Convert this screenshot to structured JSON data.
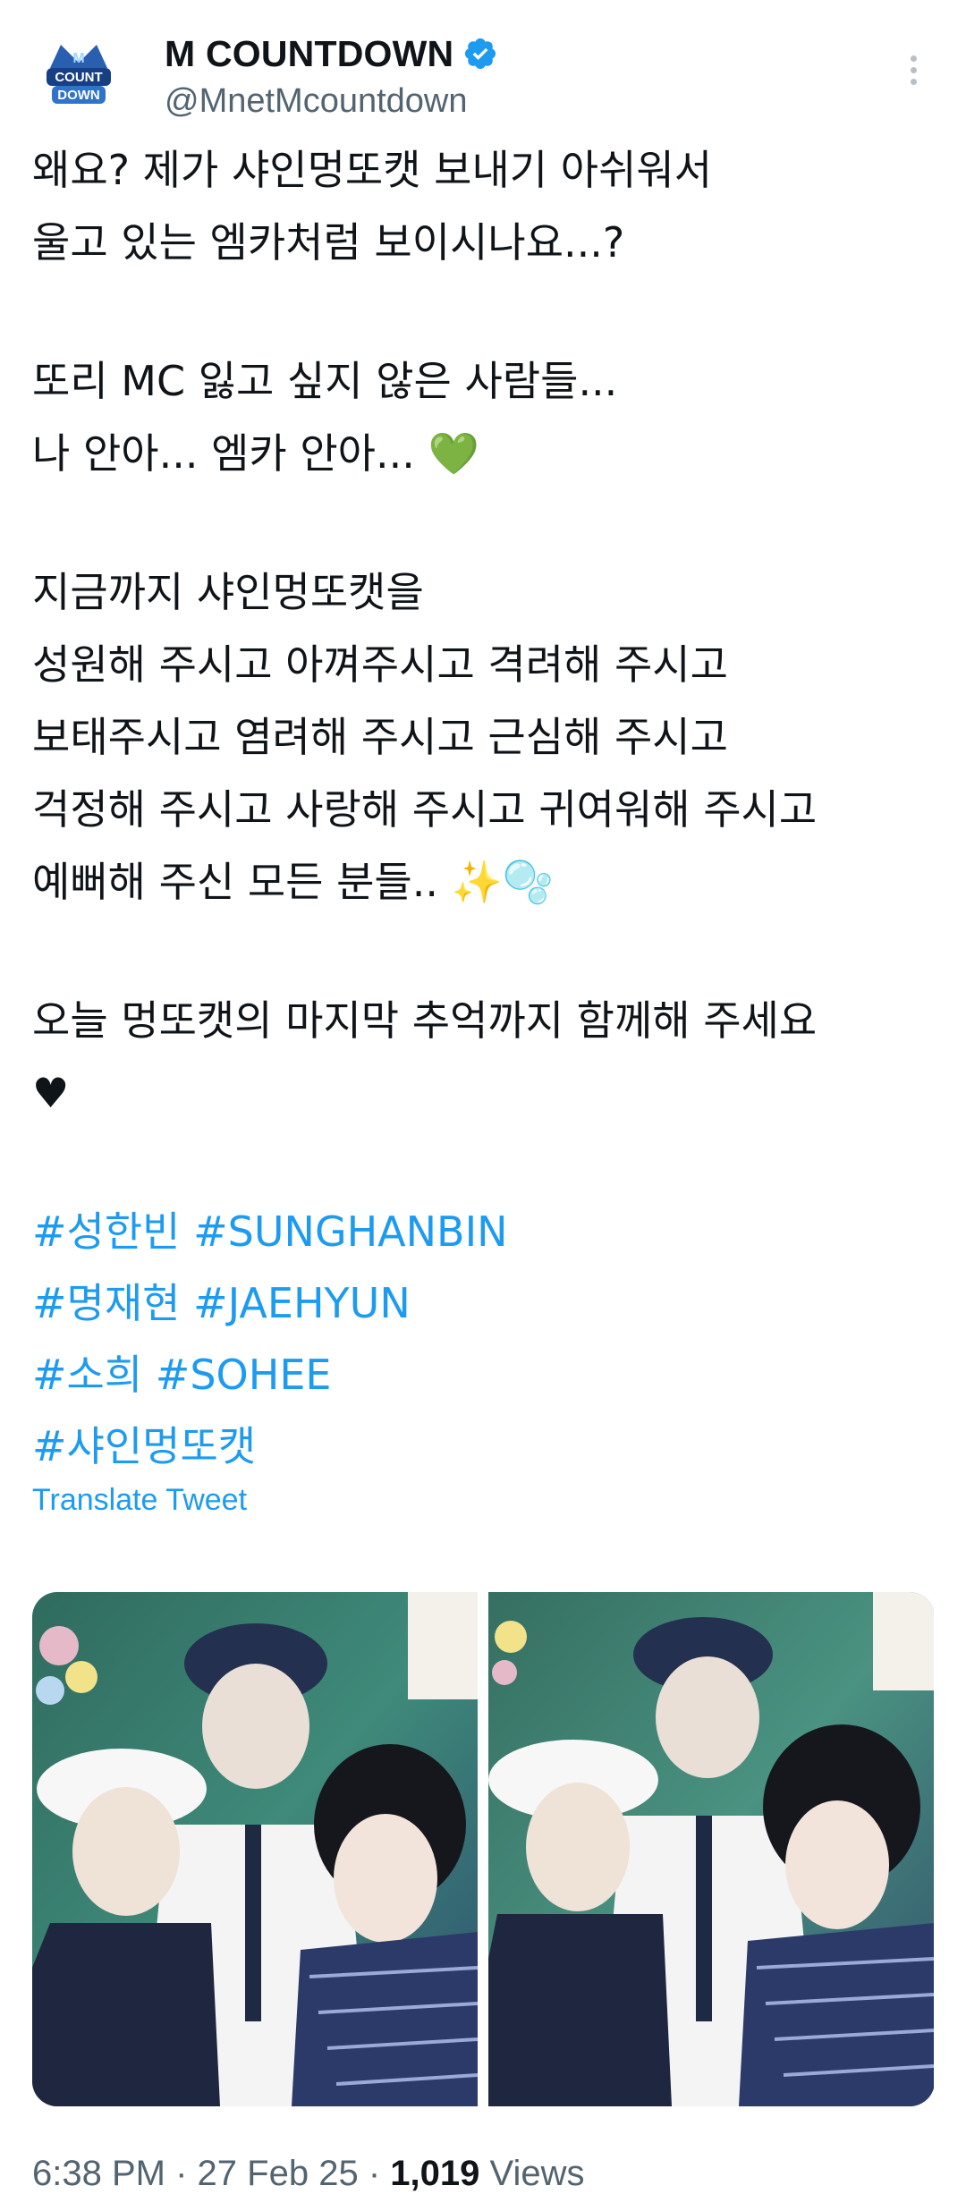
{
  "header": {
    "display_name": "M COUNTDOWN",
    "handle": "@MnetMcountdown",
    "avatar_icon": "mcountdown-logo-icon",
    "verified_icon": "verified-badge-icon",
    "more_icon": "more-vertical-icon",
    "verified_color": "#1d9bf0"
  },
  "tweet": {
    "lines": [
      "왜요? 제가 샤인멍또캣 보내기 아쉬워서",
      "울고 있는 엠카처럼 보이시나요...?",
      "",
      "또리 MC 잃고 싶지 않은 사람들...",
      "나 안아... 엠카 안아... 💚",
      "",
      "지금까지 샤인멍또캣을",
      "성원해 주시고 아껴주시고 격려해 주시고",
      "보태주시고 염려해 주시고 근심해 주시고",
      "걱정해 주시고 사랑해 주시고 귀여워해 주시고",
      "예뻐해 주신 모든 분들.. ✨🫧",
      "",
      "오늘 멍또캣의 마지막 추억까지 함께해 주세요",
      "♥",
      ""
    ],
    "hashtags": [
      "#성한빈 #SUNGHANBIN",
      "#명재현 #JAEHYUN",
      "#소희 #SOHEE",
      "#샤인멍또캣"
    ],
    "translate_label": "Translate Tweet"
  },
  "media": {
    "photos": [
      {
        "name": "photo-1"
      },
      {
        "name": "photo-2"
      }
    ]
  },
  "meta": {
    "time": "6:38 PM",
    "separator": "·",
    "date": "27 Feb 25",
    "views_count": "1,019",
    "views_label": "Views"
  },
  "colors": {
    "link": "#1d9bf0",
    "text": "#0f1419",
    "secondary": "#536471"
  }
}
